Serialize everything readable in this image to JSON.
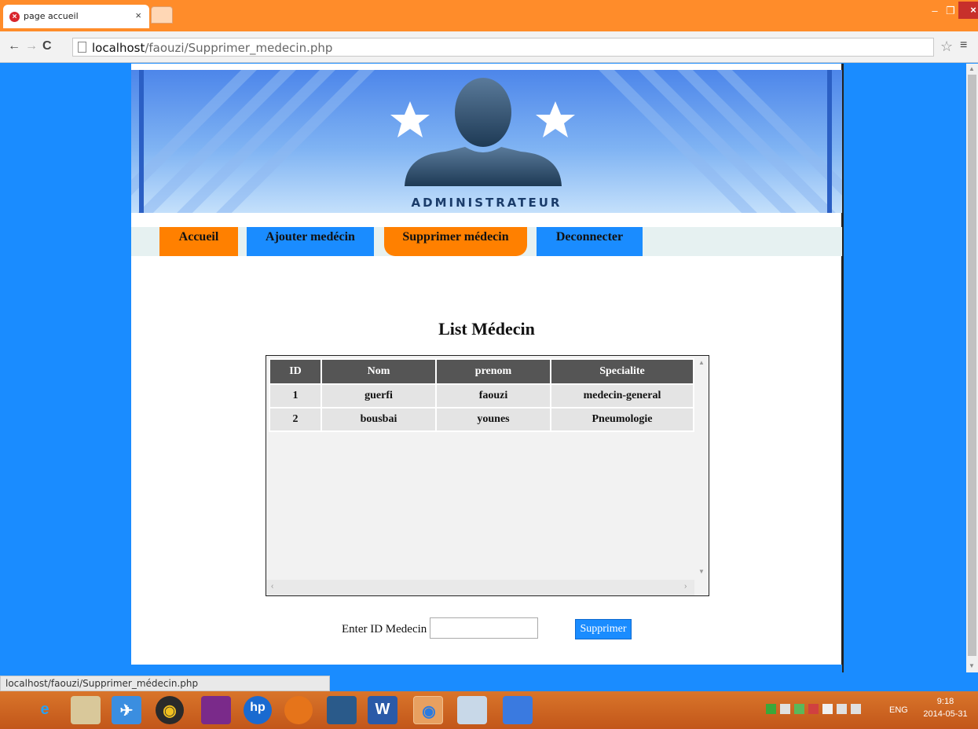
{
  "browser": {
    "tab_title": "page accueil",
    "tab_close": "×",
    "url_host": "localhost",
    "url_path": "/faouzi/Supprimer_medecin.php",
    "status_url": "localhost/faouzi/Supprimer_médecin.php"
  },
  "banner": {
    "label": "ADMINISTRATEUR"
  },
  "nav": {
    "accueil": "Accueil",
    "ajouter": "Ajouter medécin",
    "supprimer": "Supprimer médecin",
    "deconnecter": "Deconnecter",
    "active": "supprimer"
  },
  "main": {
    "heading": "List Médecin",
    "table": {
      "headers": [
        "ID",
        "Nom",
        "prenom",
        "Specialite"
      ],
      "rows": [
        [
          "1",
          "guerfi",
          "faouzi",
          "medecin-general"
        ],
        [
          "2",
          "bousbai",
          "younes",
          "Pneumologie"
        ]
      ]
    },
    "form": {
      "label": "Enter ID Medecin :",
      "input_value": "",
      "button_label": "Supprimer"
    }
  },
  "taskbar": {
    "language": "ENG",
    "time": "9:18",
    "date": "2014-05-31"
  },
  "colors": {
    "page_background": "#1a8cff",
    "nav_orange": "#ff8000",
    "nav_blue": "#1a8cff",
    "title_bar": "#ff8c2a"
  }
}
